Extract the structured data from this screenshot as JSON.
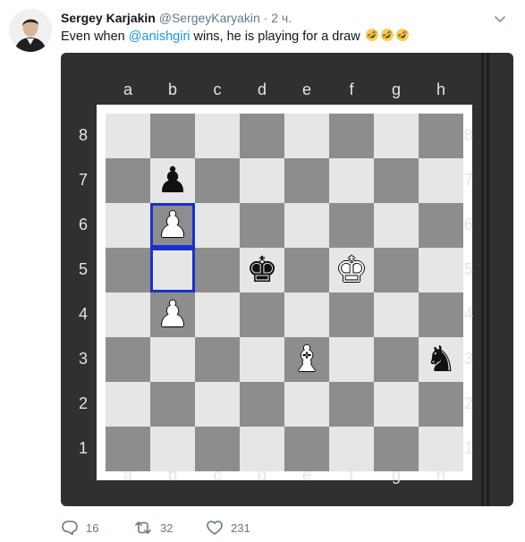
{
  "author": {
    "name": "Sergey Karjakin",
    "handle": "@SergeyKaryakin",
    "separator": "·",
    "time": "2 ч."
  },
  "tweet": {
    "text_before": "Even when ",
    "mention": "@anishgiri",
    "text_after": " wins, he is playing for a draw",
    "emoji": [
      "rolling-on-floor-laughing",
      "rolling-on-floor-laughing",
      "rolling-on-floor-laughing"
    ]
  },
  "board": {
    "files": [
      "a",
      "b",
      "c",
      "d",
      "e",
      "f",
      "g",
      "h"
    ],
    "ranks": [
      "8",
      "7",
      "6",
      "5",
      "4",
      "3",
      "2",
      "1"
    ],
    "highlight_color": "#1b2fd0",
    "highlighted_squares": [
      "b6",
      "b5"
    ],
    "pieces": [
      {
        "square": "b7",
        "type": "pawn",
        "color": "black",
        "glyph": "♟"
      },
      {
        "square": "b6",
        "type": "pawn",
        "color": "white",
        "glyph": "♟"
      },
      {
        "square": "b4",
        "type": "pawn",
        "color": "white",
        "glyph": "♟"
      },
      {
        "square": "d5",
        "type": "king",
        "color": "black",
        "glyph": "♚"
      },
      {
        "square": "f5",
        "type": "king",
        "color": "white",
        "glyph": "♚"
      },
      {
        "square": "e3",
        "type": "bishop",
        "color": "white",
        "glyph": "♝"
      },
      {
        "square": "h3",
        "type": "knight",
        "color": "black",
        "glyph": "♞"
      }
    ]
  },
  "actions": {
    "reply_count": "16",
    "retweet_count": "32",
    "like_count": "231"
  },
  "colors": {
    "name": "#14171a",
    "muted": "#657786",
    "link": "#1b95e0",
    "board_background": "#2f3032",
    "light_square": "#e6e6e6",
    "dark_square": "#8d8d8d"
  }
}
